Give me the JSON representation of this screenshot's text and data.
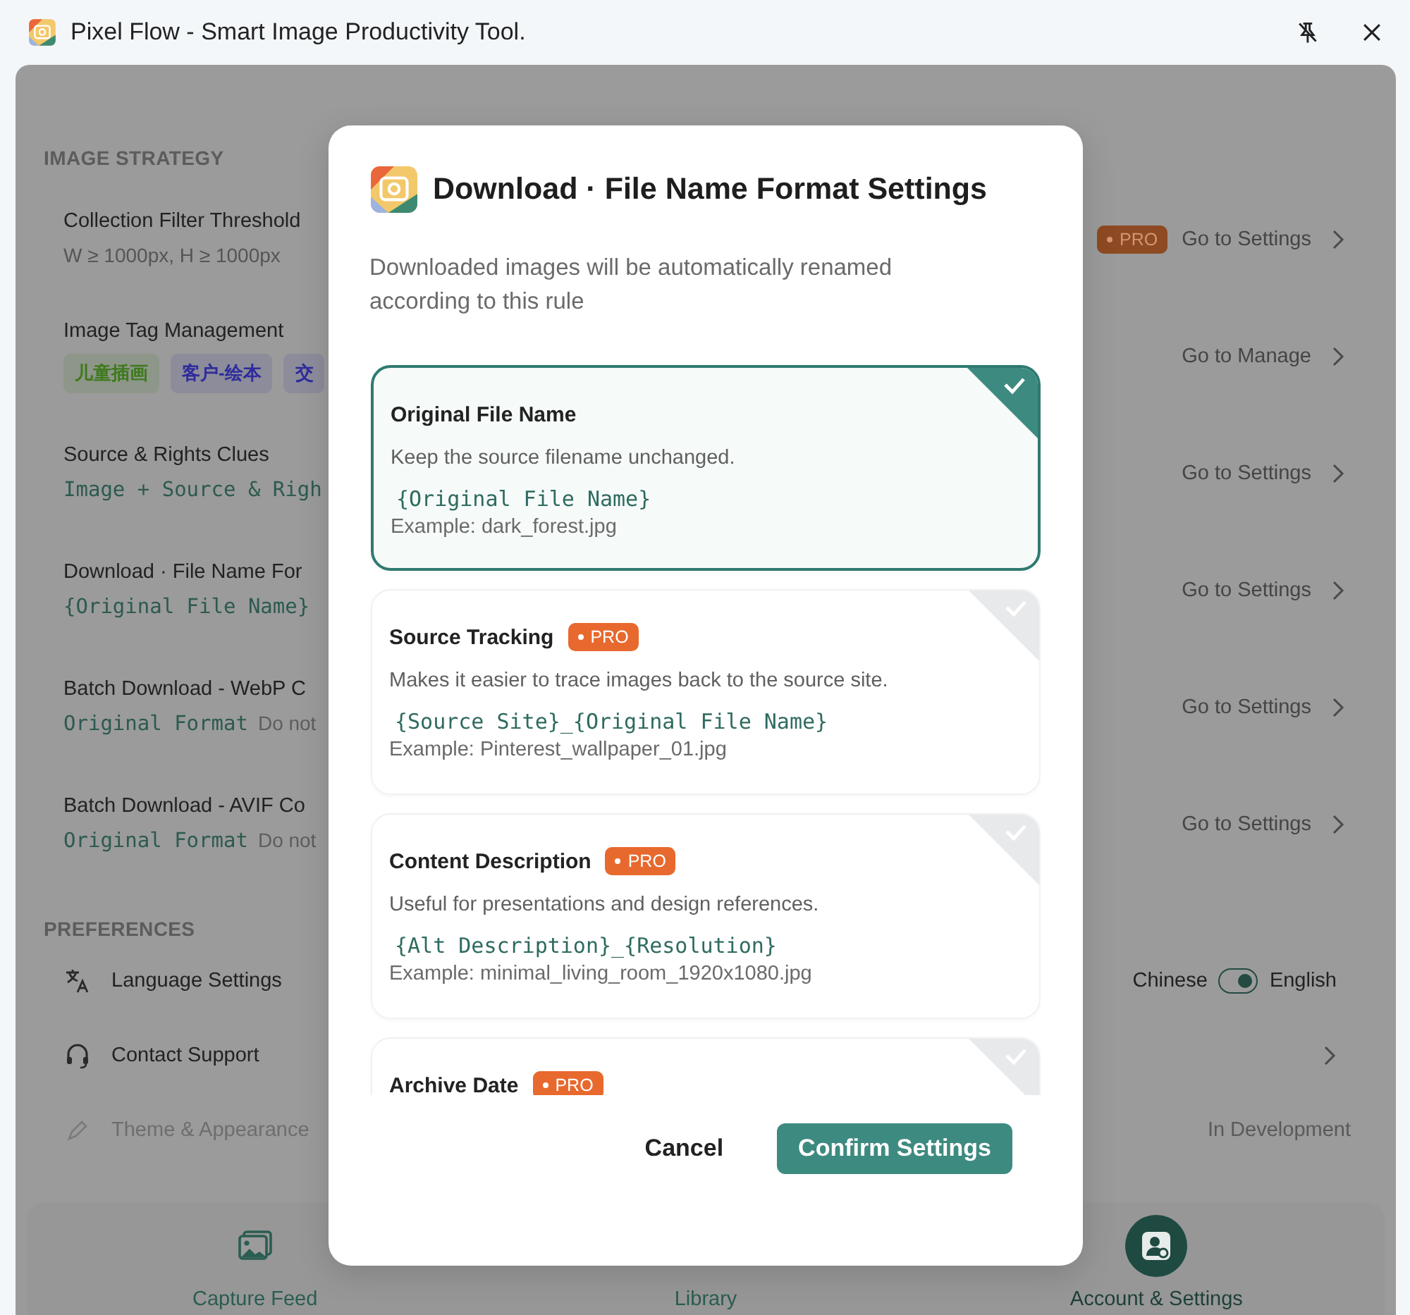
{
  "window": {
    "title": "Pixel Flow - Smart Image Productivity Tool."
  },
  "image_strategy": {
    "heading": "IMAGE STRATEGY",
    "rows": [
      {
        "kind": "plain",
        "title": "Collection Filter Threshold",
        "value": "W ≥ 1000px, H ≥ 1000px",
        "badge": "PRO",
        "action": "Go to Settings"
      },
      {
        "kind": "tags",
        "title": "Image Tag Management",
        "tags": [
          {
            "label": "儿童插画",
            "color": "#3e7a1c"
          },
          {
            "label": "客户-绘本",
            "color": "#2f2c9c"
          },
          {
            "label": "交",
            "color": "#2f2c9c"
          }
        ],
        "action": "Go to Manage"
      },
      {
        "kind": "mono",
        "title": "Source & Rights Clues",
        "value": "Image + Source & Righ",
        "action": "Go to Settings"
      },
      {
        "kind": "mono",
        "title": "Download · File Name For",
        "value": "{Original File Name}",
        "action": "Go to Settings"
      },
      {
        "kind": "mono",
        "title": "Batch Download - WebP C",
        "value": "Original Format",
        "note": "Do not",
        "action": "Go to Settings"
      },
      {
        "kind": "mono",
        "title": "Batch Download - AVIF Co",
        "value": "Original Format",
        "note": "Do not",
        "action": "Go to Settings"
      }
    ]
  },
  "preferences": {
    "heading": "PREFERENCES",
    "items": [
      {
        "kind": "toggle",
        "label": "Language Settings",
        "off_label": "Chinese",
        "on_label": "English",
        "on": true
      },
      {
        "kind": "link",
        "label": "Contact Support"
      },
      {
        "kind": "disabled",
        "label": "Theme & Appearance",
        "status": "In Development"
      }
    ]
  },
  "bottom_nav": [
    {
      "label": "Capture Feed",
      "selected": false
    },
    {
      "label": "Library",
      "selected": false
    },
    {
      "label": "Account & Settings",
      "selected": true
    }
  ],
  "dialog": {
    "title": "Download · File Name Format Settings",
    "description": "Downloaded images will be automatically renamed according to this rule",
    "options": [
      {
        "title": "Original File Name",
        "description": "Keep the source filename unchanged.",
        "pattern": "{Original File Name}",
        "example": "Example: dark_forest.jpg",
        "selected": true
      },
      {
        "title": "Source Tracking",
        "badge": "PRO",
        "description": "Makes it easier to trace images back to the source site.",
        "pattern": "{Source Site}_{Original File Name}",
        "example": "Example: Pinterest_wallpaper_01.jpg",
        "selected": false
      },
      {
        "title": "Content Description",
        "badge": "PRO",
        "description": "Useful for presentations and design references.",
        "pattern": "{Alt Description}_{Resolution}",
        "example": "Example: minimal_living_room_1920x1080.jpg",
        "selected": false
      },
      {
        "title": "Archive Date",
        "badge": "PRO",
        "selected": false
      }
    ],
    "cancel": "Cancel",
    "confirm": "Confirm Settings"
  }
}
